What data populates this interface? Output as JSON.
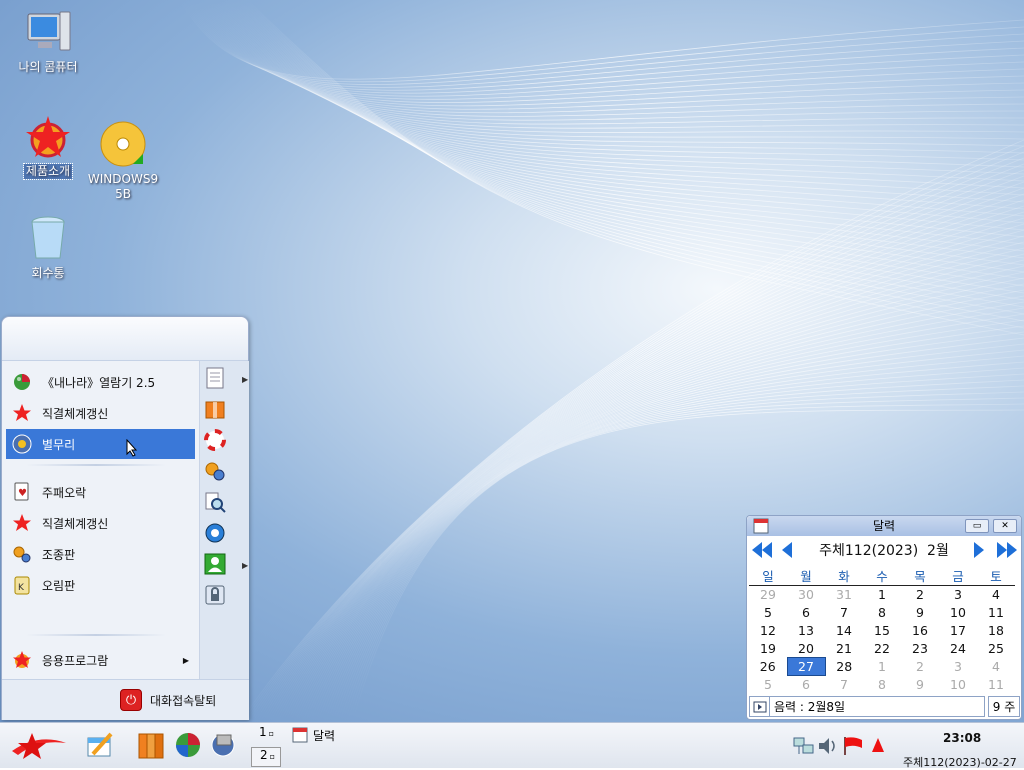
{
  "desktop": {
    "icons": [
      {
        "label": "나의 콤퓨터"
      },
      {
        "label": "제품소개"
      },
      {
        "label": "WINDOWS95B"
      },
      {
        "label": "회수통"
      }
    ]
  },
  "start_menu": {
    "items": [
      {
        "label": "《내나라》열람기 2.5",
        "icon": "globe-icon"
      },
      {
        "label": "직결체계갱신",
        "icon": "star-icon"
      },
      {
        "label": "별무리",
        "icon": "planet-icon",
        "highlighted": true
      },
      {
        "label": "주패오락",
        "icon": "cards-icon"
      },
      {
        "label": "직결체계갱신",
        "icon": "star-icon"
      },
      {
        "label": "조종판",
        "icon": "gears-icon"
      },
      {
        "label": "오림판",
        "icon": "clipboard-icon"
      },
      {
        "label": "응용프로그람",
        "icon": "red-star-icon",
        "submenu": true
      }
    ],
    "logout_label": "대화접속탈퇴"
  },
  "calendar": {
    "title": "달력",
    "month_label": "주체112(2023)  2월",
    "weekdays": [
      "일",
      "월",
      "화",
      "수",
      "목",
      "금",
      "토"
    ],
    "weeks": [
      [
        "29",
        "30",
        "31",
        "1",
        "2",
        "3",
        "4"
      ],
      [
        "5",
        "6",
        "7",
        "8",
        "9",
        "10",
        "11"
      ],
      [
        "12",
        "13",
        "14",
        "15",
        "16",
        "17",
        "18"
      ],
      [
        "19",
        "20",
        "21",
        "22",
        "23",
        "24",
        "25"
      ],
      [
        "26",
        "27",
        "28",
        "1",
        "2",
        "3",
        "4"
      ],
      [
        "5",
        "6",
        "7",
        "8",
        "9",
        "10",
        "11"
      ]
    ],
    "today": "27",
    "lunar_label": "음력 : 2월8일",
    "week_label": "9 주"
  },
  "taskbar": {
    "workspaces": [
      "1",
      "2"
    ],
    "task_label": "달력",
    "time": "23:08",
    "date": "주체112(2023)-02-27"
  }
}
